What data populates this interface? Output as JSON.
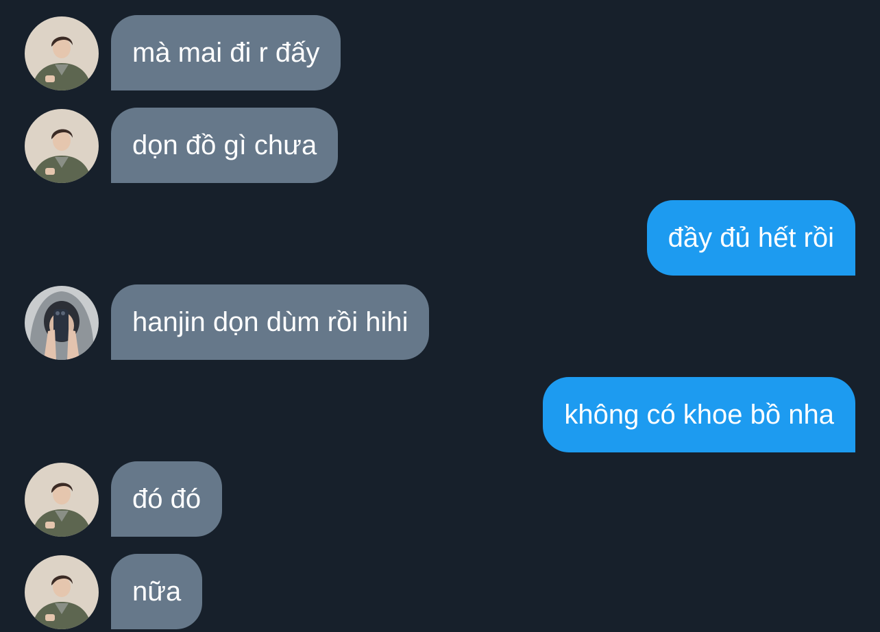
{
  "messages": [
    {
      "side": "in",
      "avatar": "avatar-icon",
      "text": "mà mai đi r đấy"
    },
    {
      "side": "in",
      "avatar": "avatar-icon",
      "text": "dọn đồ gì chưa"
    },
    {
      "side": "out",
      "text": "đầy đủ hết rồi"
    },
    {
      "side": "in",
      "avatar": "hooded-selfie-avatar-icon",
      "text": "hanjin dọn dùm rồi hihi"
    },
    {
      "side": "out",
      "text": "không có khoe bồ nha"
    },
    {
      "side": "in",
      "avatar": "avatar-icon",
      "text": "đó đó"
    },
    {
      "side": "in",
      "avatar": "avatar-icon",
      "text": "nữa"
    }
  ],
  "colors": {
    "background": "#17202b",
    "incoming_bubble": "#66788a",
    "outgoing_bubble": "#1d9bf0",
    "text": "#ffffff"
  }
}
